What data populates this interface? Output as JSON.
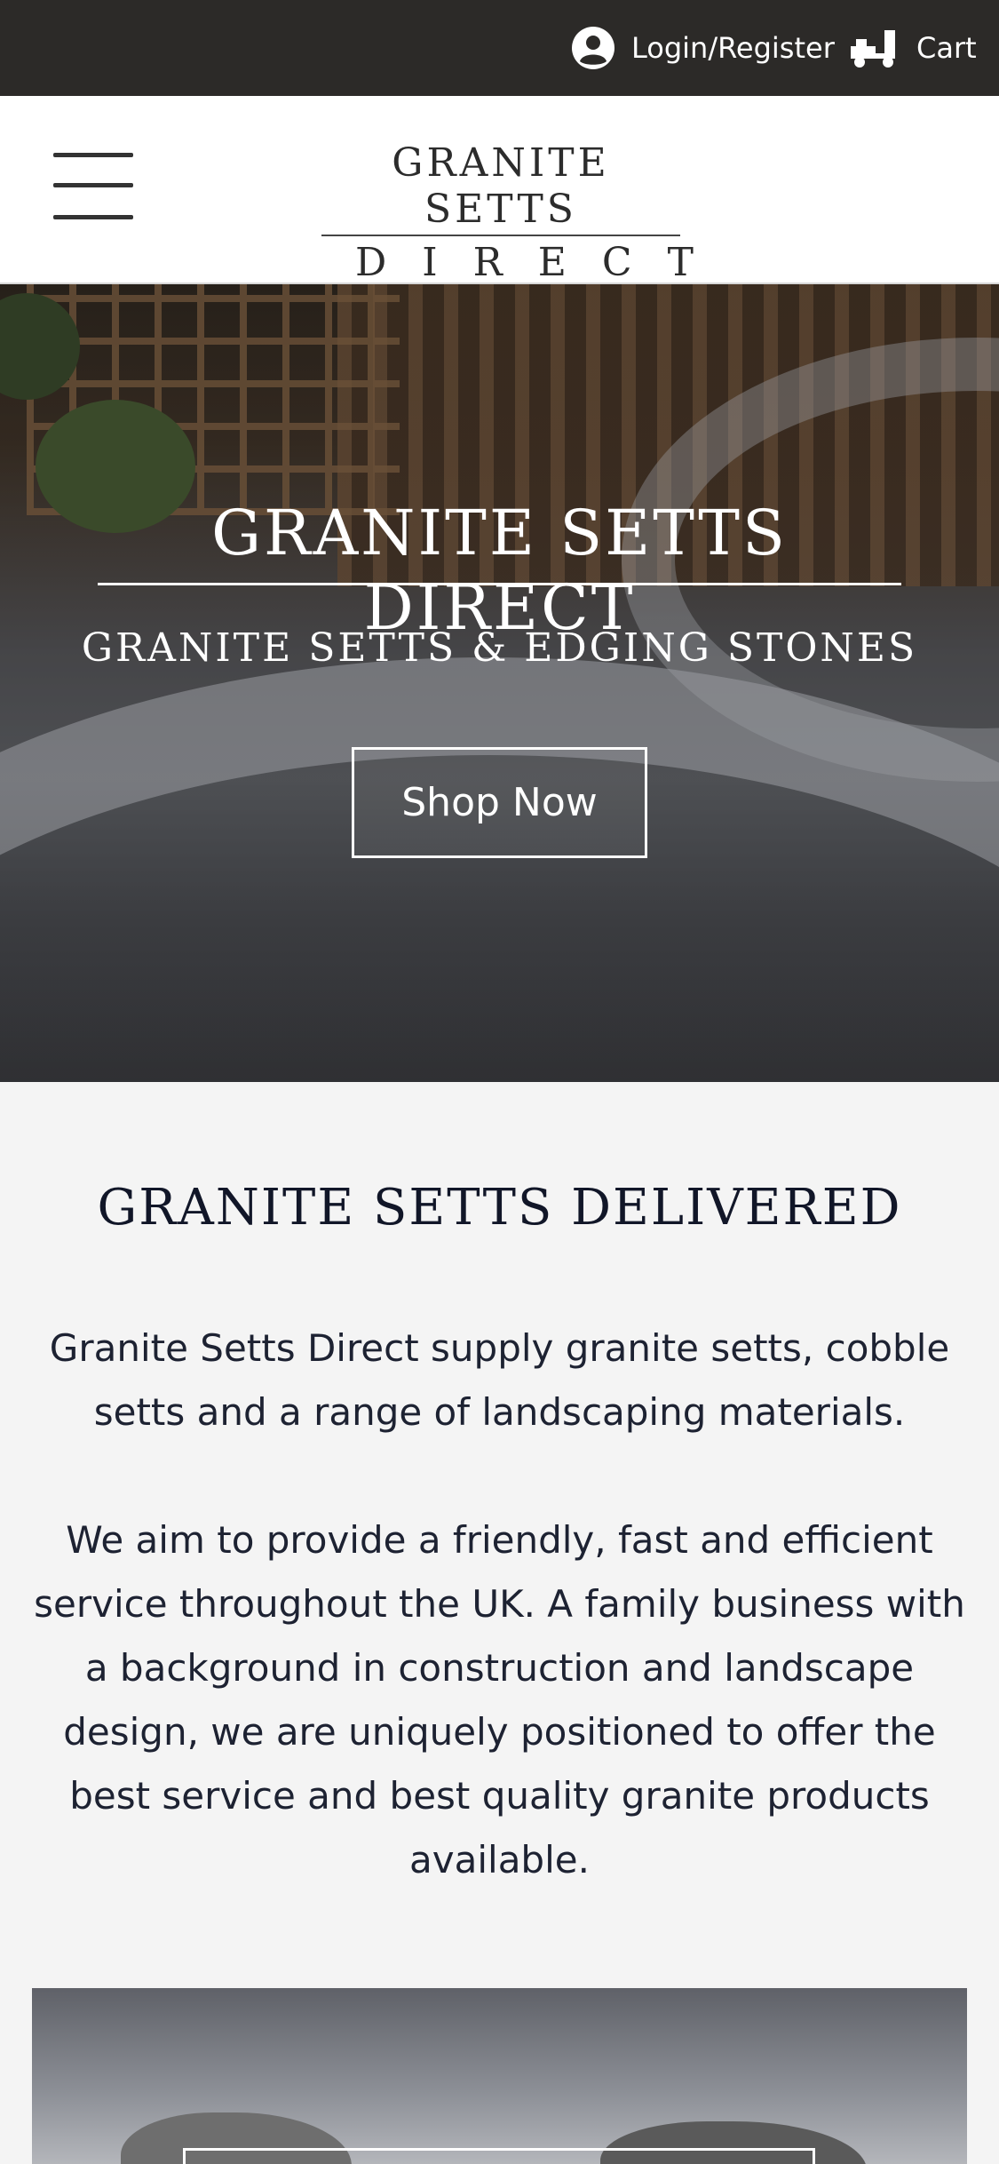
{
  "topbar": {
    "login_label": "Login/Register",
    "login_icon": "user-circle-icon",
    "cart_label": "Cart",
    "cart_icon": "cart-icon"
  },
  "header": {
    "menu_icon": "hamburger-menu-icon",
    "logo_line1": "GRANITE SETTS",
    "logo_line2": "DIRECT"
  },
  "hero": {
    "title": "GRANITE SETTS DIRECT",
    "subtitle": "GRANITE SETTS & EDGING STONES",
    "cta_label": "Shop Now"
  },
  "main": {
    "heading": "GRANITE SETTS DELIVERED",
    "paragraph1": "Granite Setts Direct supply granite setts, cobble setts and a range of landscaping materials.",
    "paragraph2": "We aim to provide a friendly, fast and efficient service throughout the UK. A family business with a background in construction and landscape design, we are uniquely positioned to offer the best service and best quality granite products available."
  },
  "colors": {
    "topbar_bg": "#2c2a28",
    "header_bg": "#ffffff",
    "page_bg": "#f4f4f4",
    "heading_text": "#111628"
  }
}
